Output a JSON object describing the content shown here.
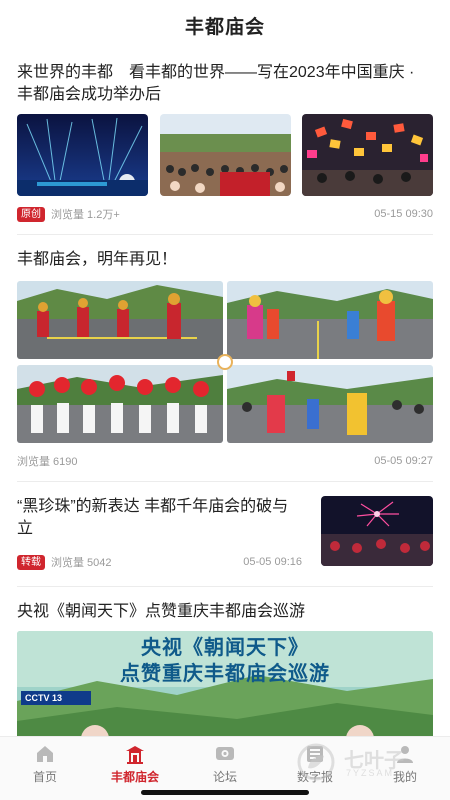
{
  "header": {
    "title": "丰都庙会"
  },
  "articles": [
    {
      "title": "来世界的丰都　看丰都的世界——写在2023年中国重庆 · 丰都庙会成功举办后",
      "badge": "原创",
      "views": "浏览量 1.2万+",
      "date": "05-15 09:30"
    },
    {
      "title": "丰都庙会，明年再见！",
      "views": "浏览量 6190",
      "date": "05-05 09:27"
    },
    {
      "title": "“黑珍珠”的新表达 丰都千年庙会的破与立",
      "badge": "转载",
      "views": "浏览量 5042",
      "date": "05-05 09:16"
    },
    {
      "title": "央视《朝闻天下》点赞重庆丰都庙会巡游",
      "banner_line1": "央视《朝闻天下》",
      "banner_line2": "点赞重庆丰都庙会巡游",
      "cctv_label": "CCTV 13"
    }
  ],
  "tabbar": {
    "items": [
      {
        "label": "首页",
        "icon": "home-icon"
      },
      {
        "label": "丰都庙会",
        "icon": "temple-icon",
        "active": true
      },
      {
        "label": "论坛",
        "icon": "forum-icon"
      },
      {
        "label": "数字报",
        "icon": "newspaper-icon"
      },
      {
        "label": "我的",
        "icon": "profile-icon"
      }
    ]
  },
  "watermark": {
    "text": "七叶子",
    "sub": "7YZSAM"
  },
  "colors": {
    "accent": "#d0262e",
    "text": "#222222",
    "meta": "#9a9a9a"
  }
}
